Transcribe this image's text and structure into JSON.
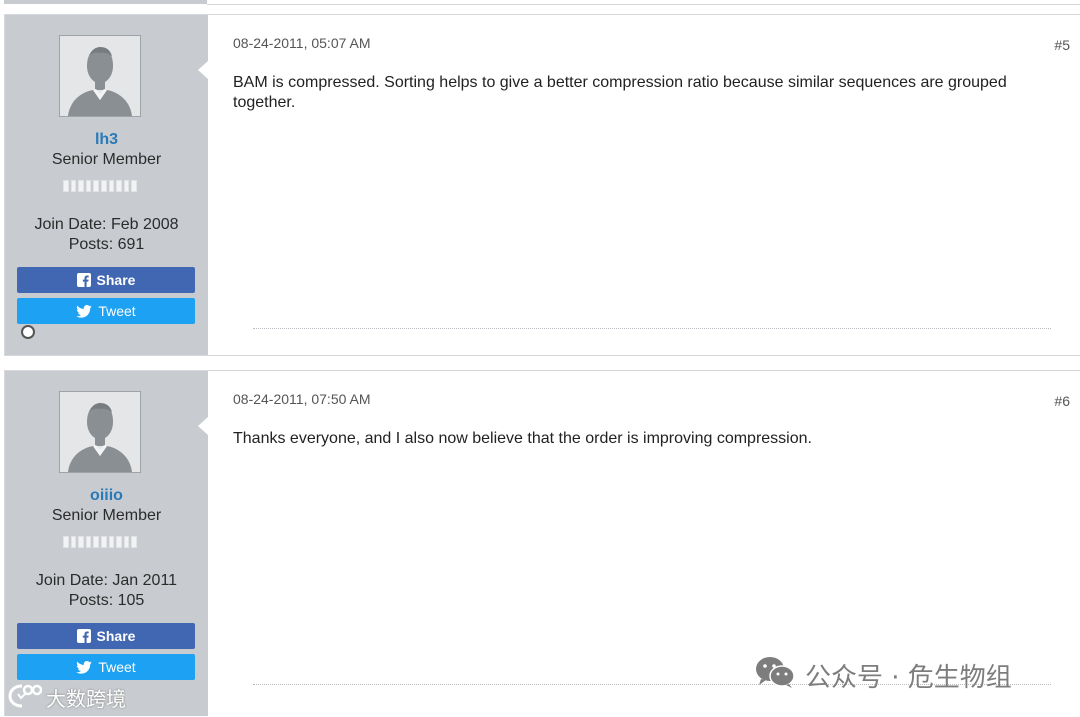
{
  "posts": [
    {
      "username": "lh3",
      "user_title": "Senior Member",
      "join_date": "Join Date: Feb 2008",
      "posts_count": "Posts: 691",
      "share_label": "Share",
      "tweet_label": "Tweet",
      "date": "08-24-2011, 05:07 AM",
      "post_number": "#5",
      "text": "BAM is compressed. Sorting helps to give a better compression ratio because similar sequences are grouped together."
    },
    {
      "username": "oiiio",
      "user_title": "Senior Member",
      "join_date": "Join Date: Jan 2011",
      "posts_count": "Posts: 105",
      "share_label": "Share",
      "tweet_label": "Tweet",
      "date": "08-24-2011, 07:50 AM",
      "post_number": "#6",
      "text": "Thanks everyone, and I also now believe that the order is improving compression."
    }
  ],
  "watermarks": {
    "right": "公众号 · 危生物组",
    "left": "大数跨境"
  },
  "colors": {
    "username": "#2a7ab8",
    "share": "#4267b2",
    "tweet": "#1da1f2",
    "sidebar": "#c8ccd0"
  },
  "icons": [
    "avatar-placeholder-icon",
    "facebook-icon",
    "twitter-icon",
    "online-status-icon",
    "wechat-icon"
  ]
}
